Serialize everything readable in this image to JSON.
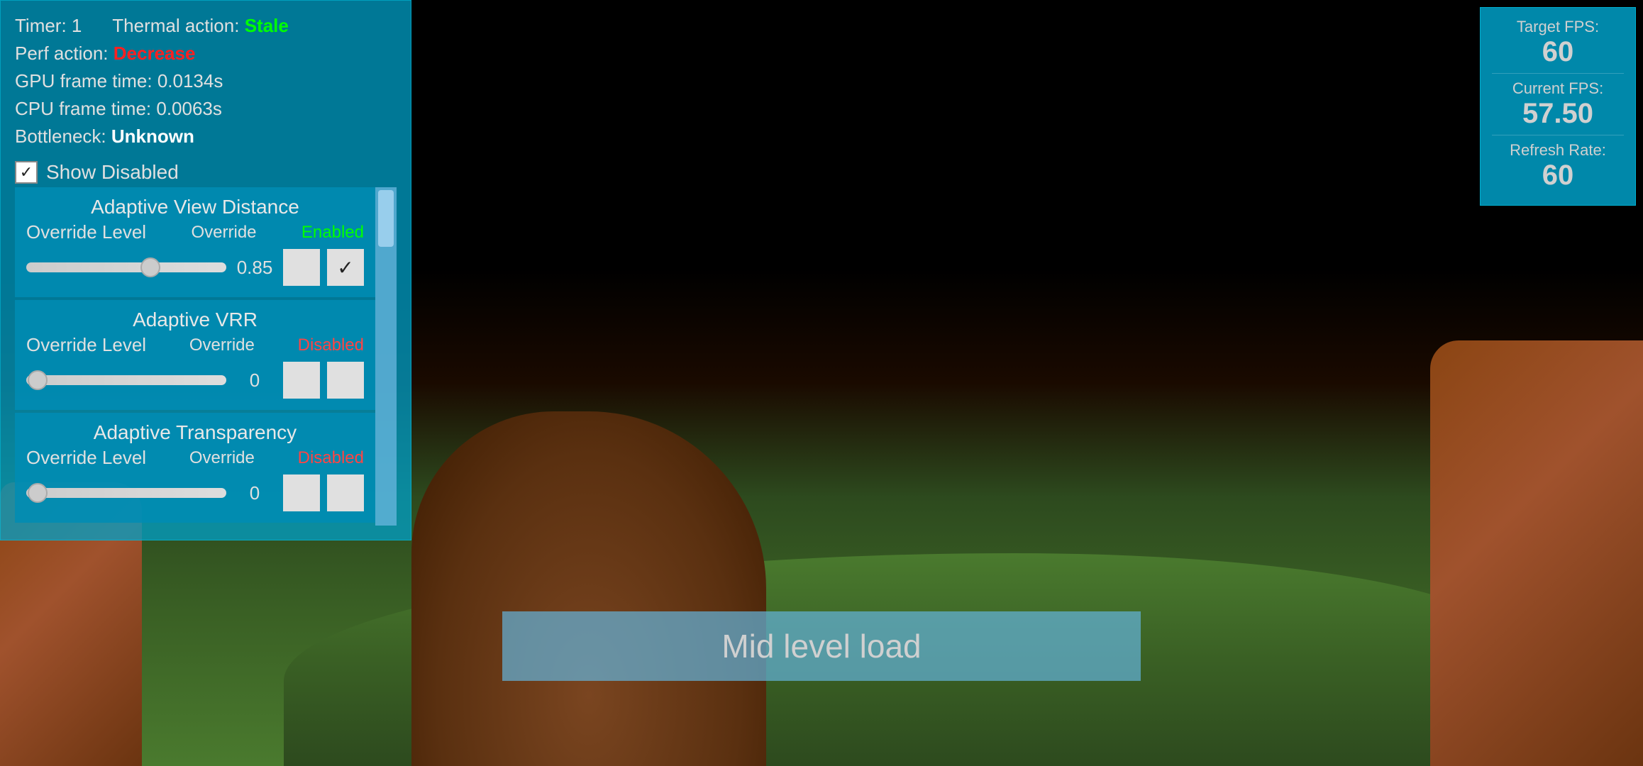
{
  "debug": {
    "timer_label": "Timer: 1",
    "thermal_action_label": "Thermal action:",
    "thermal_action_value": "Stale",
    "perf_action_label": "Perf action:",
    "perf_action_value": "Decrease",
    "gpu_frame_time": "GPU frame time: 0.0134s",
    "cpu_frame_time": "CPU frame time: 0.0063s",
    "bottleneck_label": "Bottleneck:",
    "bottleneck_value": "Unknown",
    "show_disabled_label": "Show Disabled",
    "show_disabled_checked": true
  },
  "sections": [
    {
      "id": "adaptive-view-distance",
      "title": "Adaptive View Distance",
      "override_level_label": "Override Level",
      "override_label": "Override",
      "override_status": "Enabled",
      "override_enabled": true,
      "slider_value": "0.85",
      "slider_position_pct": 62,
      "has_check": true
    },
    {
      "id": "adaptive-vrr",
      "title": "Adaptive VRR",
      "override_level_label": "Override Level",
      "override_label": "Override",
      "override_status": "Disabled",
      "override_enabled": false,
      "slider_value": "0",
      "slider_position_pct": 0,
      "has_check": false
    },
    {
      "id": "adaptive-transparency",
      "title": "Adaptive Transparency",
      "override_level_label": "Override Level",
      "override_label": "Override",
      "override_status": "Disabled",
      "override_enabled": false,
      "slider_value": "0",
      "slider_position_pct": 0,
      "has_check": false
    }
  ],
  "fps": {
    "target_label": "Target FPS:",
    "target_value": "60",
    "current_label": "Current FPS:",
    "current_value": "57.50",
    "refresh_label": "Refresh Rate:",
    "refresh_value": "60"
  },
  "banner": {
    "text": "Mid level load"
  }
}
